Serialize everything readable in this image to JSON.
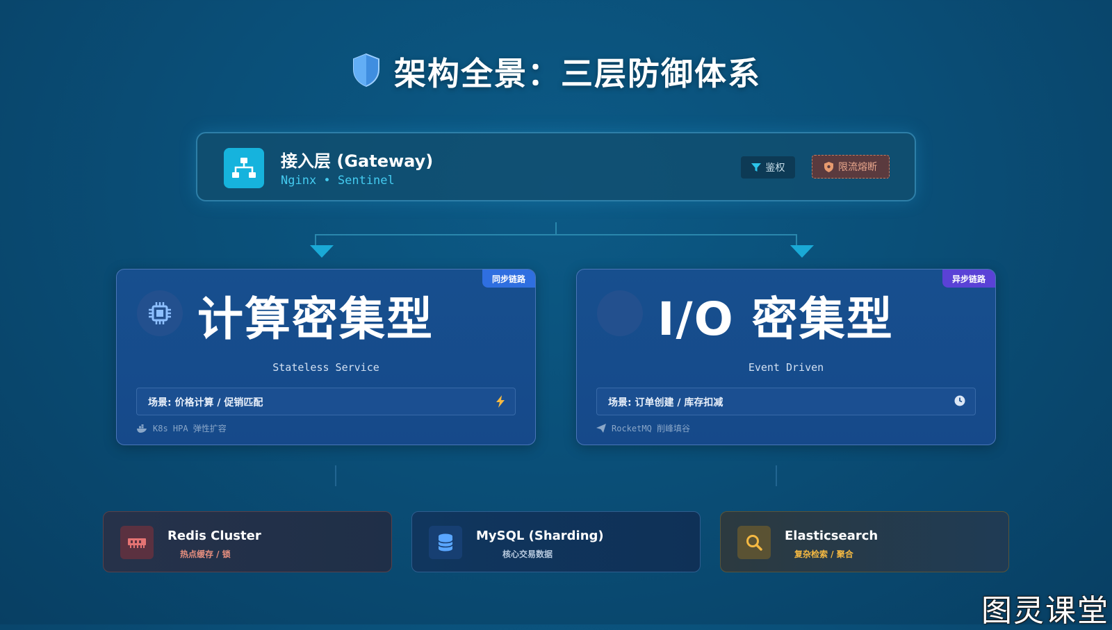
{
  "title": "架构全景：三层防御体系",
  "gateway": {
    "title": "接入层 (Gateway)",
    "subtitle": "Nginx • Sentinel",
    "badges": {
      "auth": "鉴权",
      "rate_limit": "限流熔断"
    }
  },
  "compute": {
    "tag": "同步链路",
    "title": "计算密集型",
    "caption": "Stateless Service",
    "scene": "场景: 价格计算 / 促销匹配",
    "footer": "K8s HPA 弹性扩容"
  },
  "io": {
    "tag": "异步链路",
    "title": "I/O 密集型",
    "caption": "Event Driven",
    "scene": "场景: 订单创建 / 库存扣减",
    "footer": "RocketMQ 削峰填谷"
  },
  "storage": [
    {
      "name": "Redis Cluster",
      "desc": "热点缓存 / 锁",
      "icon": "memory-icon"
    },
    {
      "name": "MySQL (Sharding)",
      "desc": "核心交易数据",
      "icon": "database-icon"
    },
    {
      "name": "Elasticsearch",
      "desc": "复杂检索 / 聚合",
      "icon": "search-icon"
    }
  ],
  "watermark": "图灵课堂",
  "colors": {
    "accent": "#16b3dd",
    "sync_tag": "#2f6fe0",
    "async_tag": "#5a42d6",
    "redis": "#e57373",
    "mysql": "#5aa6ff",
    "elastic": "#f5b942"
  }
}
